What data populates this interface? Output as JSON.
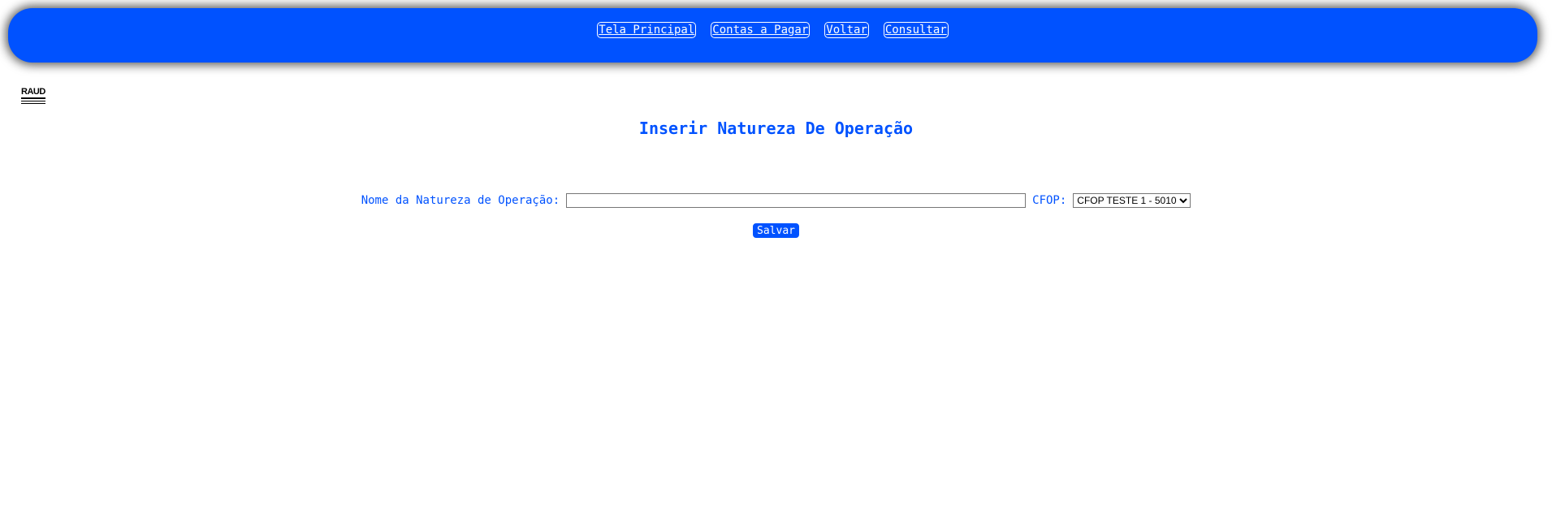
{
  "nav": {
    "items": [
      {
        "label": "Tela Principal"
      },
      {
        "label": "Contas a Pagar"
      },
      {
        "label": "Voltar"
      },
      {
        "label": "Consultar"
      }
    ]
  },
  "logo": {
    "text": "RAUD"
  },
  "page": {
    "title": "Inserir Natureza De Operação"
  },
  "form": {
    "name_label": "Nome da Natureza de Operação:",
    "name_value": "",
    "cfop_label": "CFOP:",
    "cfop_selected": "CFOP TESTE 1 - 5010",
    "save_label": "Salvar"
  },
  "colors": {
    "accent": "#0052ff",
    "background": "#ffffff"
  }
}
